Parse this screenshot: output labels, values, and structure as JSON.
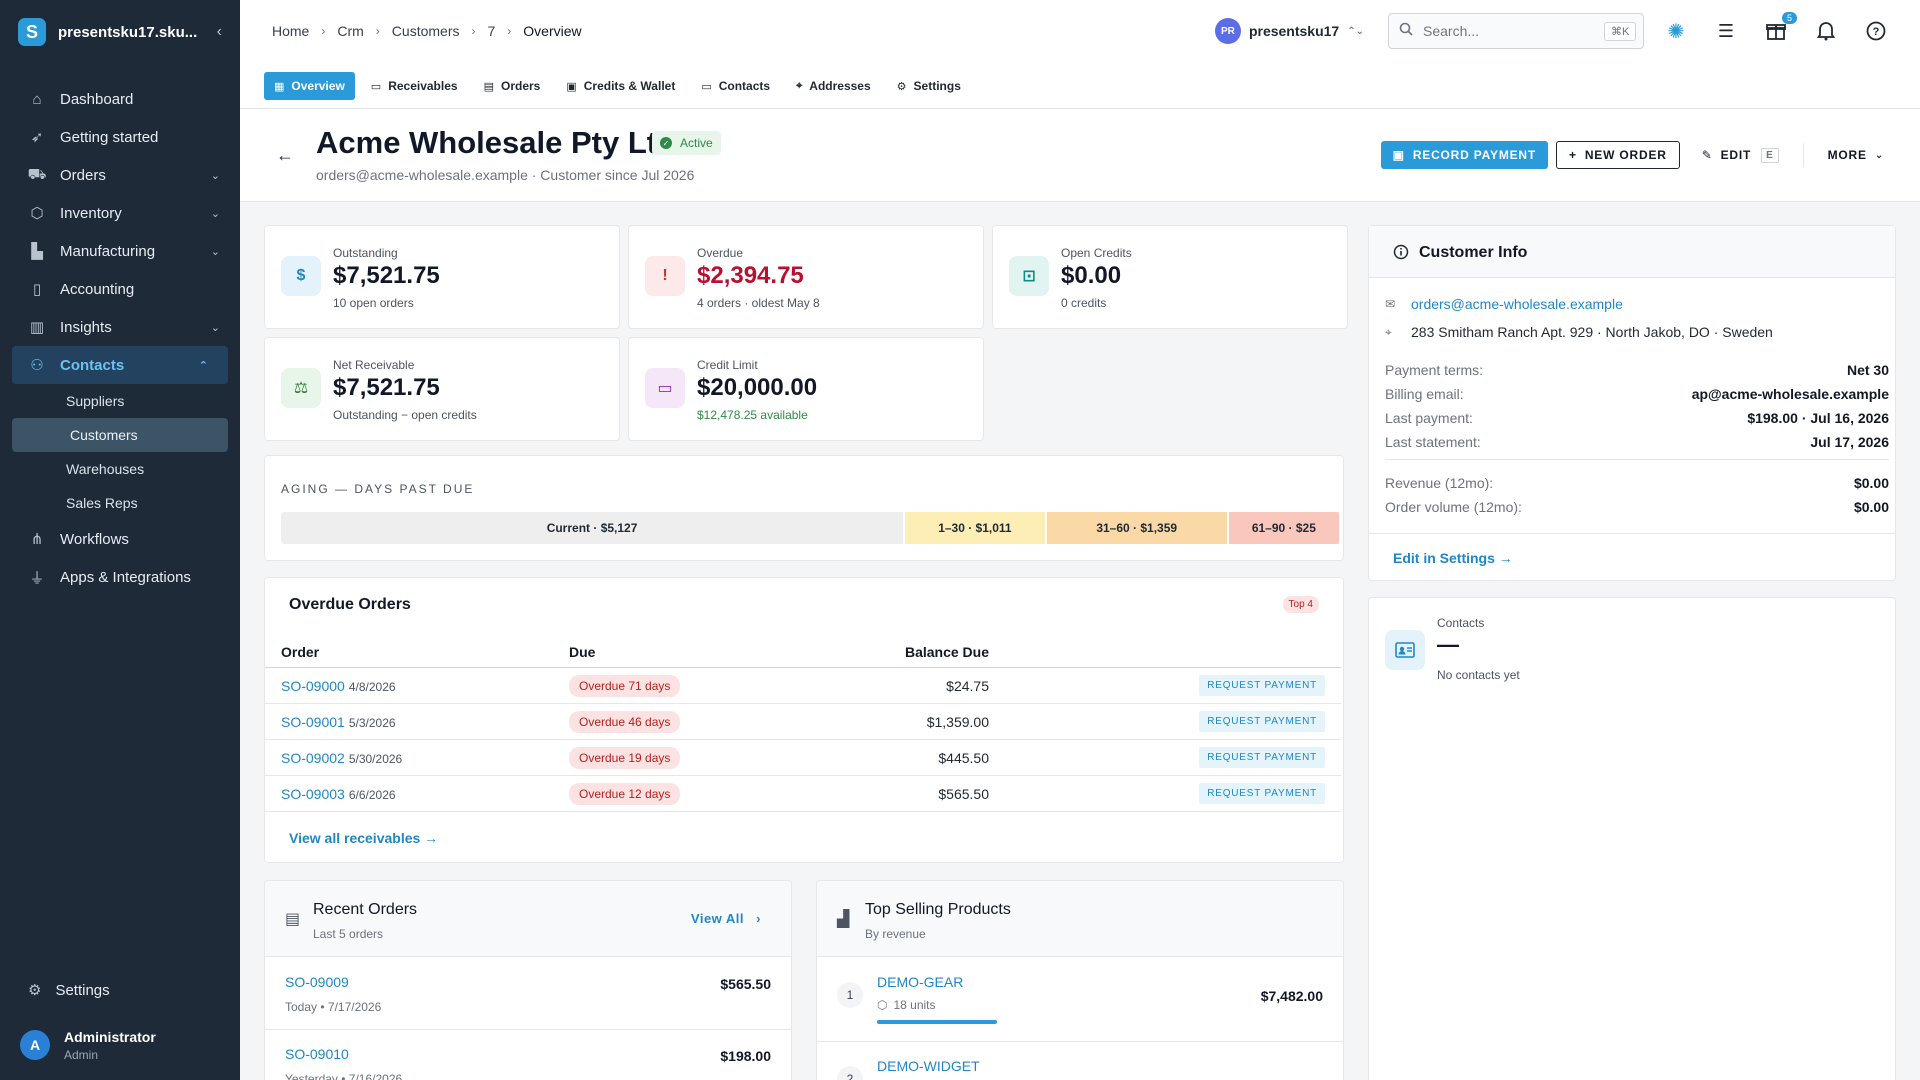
{
  "sidebar": {
    "org_name": "presentsku17.sku...",
    "logo_letter": "S",
    "items": [
      {
        "label": "Dashboard",
        "icon": "home-icon"
      },
      {
        "label": "Getting started",
        "icon": "rocket-icon"
      },
      {
        "label": "Orders",
        "icon": "cart-icon",
        "expandable": true
      },
      {
        "label": "Inventory",
        "icon": "box-icon",
        "expandable": true
      },
      {
        "label": "Manufacturing",
        "icon": "factory-icon",
        "expandable": true
      },
      {
        "label": "Accounting",
        "icon": "book-icon"
      },
      {
        "label": "Insights",
        "icon": "chart-icon",
        "expandable": true
      },
      {
        "label": "Contacts",
        "icon": "people-icon",
        "expanded": true,
        "active": true
      }
    ],
    "sub_items": [
      {
        "label": "Suppliers"
      },
      {
        "label": "Customers",
        "active": true
      },
      {
        "label": "Warehouses"
      },
      {
        "label": "Sales Reps"
      }
    ],
    "items_after": [
      {
        "label": "Workflows",
        "icon": "workflow-icon"
      },
      {
        "label": "Apps & Integrations",
        "icon": "plug-icon"
      }
    ],
    "settings_label": "Settings",
    "user": {
      "initial": "A",
      "name": "Administrator",
      "role": "Admin"
    }
  },
  "topbar": {
    "breadcrumbs": [
      "Home",
      "Crm",
      "Customers",
      "7",
      "Overview"
    ],
    "org_initials": "PR",
    "org_label": "presentsku17",
    "search_placeholder": "Search...",
    "search_shortcut": "⌘K",
    "gift_badge": "5"
  },
  "tabs": [
    {
      "label": "Overview",
      "icon": "grid-icon",
      "active": true
    },
    {
      "label": "Receivables",
      "icon": "cash-icon"
    },
    {
      "label": "Orders",
      "icon": "list-icon"
    },
    {
      "label": "Credits & Wallet",
      "icon": "wallet-icon"
    },
    {
      "label": "Contacts",
      "icon": "contact-card-icon"
    },
    {
      "label": "Addresses",
      "icon": "pin-icon"
    },
    {
      "label": "Settings",
      "icon": "gear-icon"
    }
  ],
  "customer": {
    "name": "Acme Wholesale Pty Ltd",
    "status": "Active",
    "subtitle": "orders@acme-wholesale.example · Customer since Jul 2026",
    "actions": {
      "record_payment": "RECORD PAYMENT",
      "new_order": "NEW ORDER",
      "edit": "EDIT",
      "edit_shortcut": "E",
      "more": "MORE"
    }
  },
  "kpis": [
    {
      "label": "Outstanding",
      "value": "$7,521.75",
      "sub": "10 open orders",
      "icon": "$",
      "bg": "#e3f2fb",
      "fg": "#1e88c7",
      "value_color": "#111827",
      "sub_color": "#4b5563"
    },
    {
      "label": "Overdue",
      "value": "$2,394.75",
      "sub": "4 orders · oldest May 8",
      "icon": "!",
      "bg": "#fde8ea",
      "fg": "#c0392b",
      "value_color": "#b8102e",
      "sub_color": "#4b5563"
    },
    {
      "label": "Open Credits",
      "value": "$0.00",
      "sub": "0 credits",
      "icon": "⊡",
      "bg": "#e2f4f1",
      "fg": "#0f8a7e",
      "value_color": "#111827",
      "sub_color": "#4b5563"
    },
    {
      "label": "Net Receivable",
      "value": "$7,521.75",
      "sub": "Outstanding − open credits",
      "icon": "⚖",
      "bg": "#e8f5e9",
      "fg": "#2e7d32",
      "value_color": "#111827",
      "sub_color": "#4b5563"
    },
    {
      "label": "Credit Limit",
      "value": "$20,000.00",
      "sub": "$12,478.25 available",
      "icon": "▭",
      "bg": "#f5e6f8",
      "fg": "#9c27b0",
      "value_color": "#111827",
      "sub_color": "#2e8b47"
    }
  ],
  "aging": {
    "title": "AGING — DAYS PAST DUE",
    "segments": [
      {
        "label": "Current · $5,127",
        "amount": 5127,
        "color": "#eeeeee"
      },
      {
        "label": "1–30 · $1,011",
        "amount": 1011,
        "color": "#fdeeb5"
      },
      {
        "label": "31–60 · $1,359",
        "amount": 1359,
        "color": "#fbd9a6"
      },
      {
        "label": "61–90 · $25",
        "amount": 25,
        "color": "#f9c7bc"
      }
    ]
  },
  "overdue_orders": {
    "title": "Overdue Orders",
    "badge": "Top 4",
    "columns": [
      "Order",
      "Due",
      "Balance Due"
    ],
    "rows": [
      {
        "id": "SO-09000",
        "date": "4/8/2026",
        "due": "Overdue 71 days",
        "balance": "$24.75",
        "action": "REQUEST PAYMENT"
      },
      {
        "id": "SO-09001",
        "date": "5/3/2026",
        "due": "Overdue 46 days",
        "balance": "$1,359.00",
        "action": "REQUEST PAYMENT"
      },
      {
        "id": "SO-09002",
        "date": "5/30/2026",
        "due": "Overdue 19 days",
        "balance": "$445.50",
        "action": "REQUEST PAYMENT"
      },
      {
        "id": "SO-09003",
        "date": "6/6/2026",
        "due": "Overdue 12 days",
        "balance": "$565.50",
        "action": "REQUEST PAYMENT"
      }
    ],
    "view_all": "View all receivables →"
  },
  "recent_orders": {
    "title": "Recent Orders",
    "subtitle": "Last 5 orders",
    "view_all": "View All",
    "rows": [
      {
        "id": "SO-09009",
        "date": "Today • 7/17/2026",
        "amount": "$565.50"
      },
      {
        "id": "SO-09010",
        "date": "Yesterday • 7/16/2026",
        "amount": "$198.00"
      }
    ]
  },
  "top_products": {
    "title": "Top Selling Products",
    "subtitle": "By revenue",
    "rows": [
      {
        "rank": "1",
        "name": "DEMO-GEAR",
        "units": "18 units",
        "amount": "$7,482.00"
      },
      {
        "rank": "2",
        "name": "DEMO-WIDGET",
        "units": "",
        "amount": ""
      }
    ]
  },
  "customer_info": {
    "title": "Customer Info",
    "email": "orders@acme-wholesale.example",
    "address": "283 Smitham Ranch Apt. 929 · North Jakob, DO · Sweden",
    "fields": [
      {
        "k": "Payment terms:",
        "v": "Net 30"
      },
      {
        "k": "Billing email:",
        "v": "ap@acme-wholesale.example"
      },
      {
        "k": "Last payment:",
        "v": "$198.00 · Jul 16, 2026"
      },
      {
        "k": "Last statement:",
        "v": "Jul 17, 2026"
      }
    ],
    "stats": [
      {
        "k": "Revenue (12mo):",
        "v": "$0.00"
      },
      {
        "k": "Order volume (12mo):",
        "v": "$0.00"
      }
    ],
    "edit_link": "Edit in Settings →"
  },
  "contacts_card": {
    "label": "Contacts",
    "value": "—",
    "sub": "No contacts yet"
  }
}
